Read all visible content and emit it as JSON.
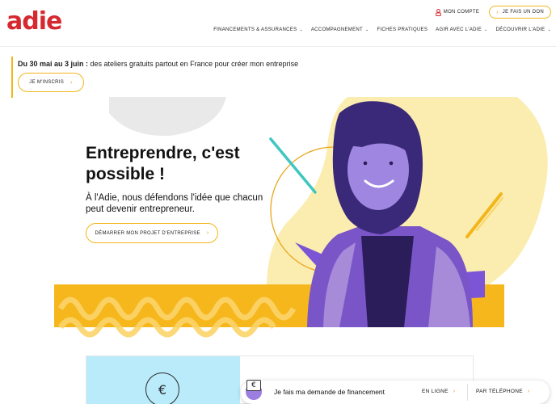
{
  "brand": {
    "logo_text": "adie",
    "color": "#d6282f"
  },
  "utility": {
    "account_label": "MON COMPTE",
    "account_icon": "user-icon",
    "donate_label": "JE FAIS UN DON"
  },
  "nav": {
    "items": [
      {
        "label": "FINANCEMENTS & ASSURANCES",
        "has_dropdown": true
      },
      {
        "label": "ACCOMPAGNEMENT",
        "has_dropdown": true
      },
      {
        "label": "FICHES PRATIQUES",
        "has_dropdown": false
      },
      {
        "label": "AGIR AVEC L'ADIE",
        "has_dropdown": true
      },
      {
        "label": "DÉCOUVRIR L'ADIE",
        "has_dropdown": true
      }
    ]
  },
  "announcement": {
    "dates": "Du 30 mai au 3 juin :",
    "text": " des ateliers gratuits partout en France pour créer mon entreprise",
    "button_label": "JE M'INSCRIS"
  },
  "hero": {
    "title": "Entreprendre, c'est possible !",
    "subtitle": "À l'Adie, nous défendons l'idée que chacun peut devenir entrepreneur.",
    "cta_label": "DÉMARRER MON PROJET D'ENTREPRISE"
  },
  "card": {
    "coin_symbol": "€"
  },
  "sticky": {
    "badge_symbol": "€",
    "text": "Je fais ma demande de financement",
    "online_label": "EN LIGNE",
    "phone_label": "PAR TÉLÉPHONE"
  },
  "colors": {
    "accent_yellow": "#f2b61b",
    "orange_chevron": "#e4931b",
    "purple": "#7b55d6",
    "light_blue": "#b9ebfb",
    "teal": "#3ec7c0"
  }
}
